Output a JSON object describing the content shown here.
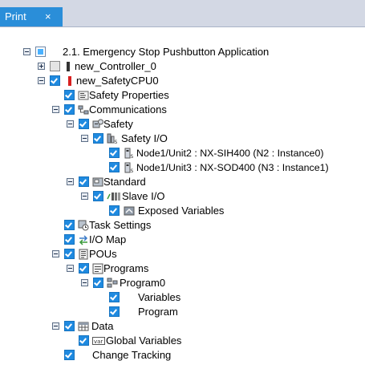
{
  "tab": {
    "label": "Print",
    "close": "×"
  },
  "tree": {
    "root": "2.1. Emergency Stop Pushbutton Application",
    "controller": "new_Controller_0",
    "safety_cpu": "new_SafetyCPU0",
    "safety_properties": "Safety Properties",
    "communications": "Communications",
    "safety": "Safety",
    "safety_io": "Safety I/O",
    "node1": "Node1/Unit2 : NX-SIH400 (N2 : Instance0)",
    "node2": "Node1/Unit3 : NX-SOD400 (N3 : Instance1)",
    "standard": "Standard",
    "slave_io": "Slave I/O",
    "exposed_variables": "Exposed Variables",
    "task_settings": "Task Settings",
    "io_map": "I/O Map",
    "pous": "POUs",
    "programs": "Programs",
    "program0": "Program0",
    "variables": "Variables",
    "program": "Program",
    "data": "Data",
    "global_variables": "Global Variables",
    "change_tracking": "Change Tracking"
  }
}
